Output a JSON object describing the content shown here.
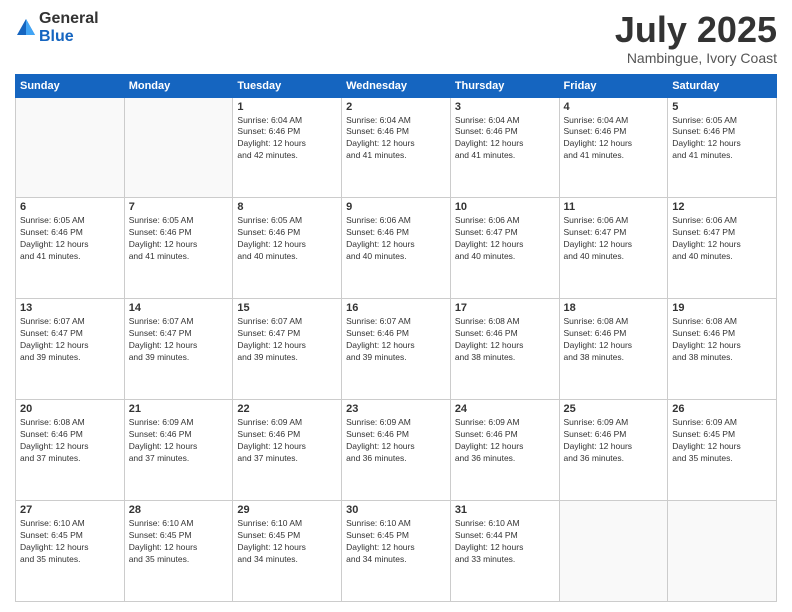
{
  "logo": {
    "general": "General",
    "blue": "Blue"
  },
  "header": {
    "title": "July 2025",
    "subtitle": "Nambingue, Ivory Coast"
  },
  "weekdays": [
    "Sunday",
    "Monday",
    "Tuesday",
    "Wednesday",
    "Thursday",
    "Friday",
    "Saturday"
  ],
  "weeks": [
    [
      {
        "day": "",
        "info": ""
      },
      {
        "day": "",
        "info": ""
      },
      {
        "day": "1",
        "info": "Sunrise: 6:04 AM\nSunset: 6:46 PM\nDaylight: 12 hours\nand 42 minutes."
      },
      {
        "day": "2",
        "info": "Sunrise: 6:04 AM\nSunset: 6:46 PM\nDaylight: 12 hours\nand 41 minutes."
      },
      {
        "day": "3",
        "info": "Sunrise: 6:04 AM\nSunset: 6:46 PM\nDaylight: 12 hours\nand 41 minutes."
      },
      {
        "day": "4",
        "info": "Sunrise: 6:04 AM\nSunset: 6:46 PM\nDaylight: 12 hours\nand 41 minutes."
      },
      {
        "day": "5",
        "info": "Sunrise: 6:05 AM\nSunset: 6:46 PM\nDaylight: 12 hours\nand 41 minutes."
      }
    ],
    [
      {
        "day": "6",
        "info": "Sunrise: 6:05 AM\nSunset: 6:46 PM\nDaylight: 12 hours\nand 41 minutes."
      },
      {
        "day": "7",
        "info": "Sunrise: 6:05 AM\nSunset: 6:46 PM\nDaylight: 12 hours\nand 41 minutes."
      },
      {
        "day": "8",
        "info": "Sunrise: 6:05 AM\nSunset: 6:46 PM\nDaylight: 12 hours\nand 40 minutes."
      },
      {
        "day": "9",
        "info": "Sunrise: 6:06 AM\nSunset: 6:46 PM\nDaylight: 12 hours\nand 40 minutes."
      },
      {
        "day": "10",
        "info": "Sunrise: 6:06 AM\nSunset: 6:47 PM\nDaylight: 12 hours\nand 40 minutes."
      },
      {
        "day": "11",
        "info": "Sunrise: 6:06 AM\nSunset: 6:47 PM\nDaylight: 12 hours\nand 40 minutes."
      },
      {
        "day": "12",
        "info": "Sunrise: 6:06 AM\nSunset: 6:47 PM\nDaylight: 12 hours\nand 40 minutes."
      }
    ],
    [
      {
        "day": "13",
        "info": "Sunrise: 6:07 AM\nSunset: 6:47 PM\nDaylight: 12 hours\nand 39 minutes."
      },
      {
        "day": "14",
        "info": "Sunrise: 6:07 AM\nSunset: 6:47 PM\nDaylight: 12 hours\nand 39 minutes."
      },
      {
        "day": "15",
        "info": "Sunrise: 6:07 AM\nSunset: 6:47 PM\nDaylight: 12 hours\nand 39 minutes."
      },
      {
        "day": "16",
        "info": "Sunrise: 6:07 AM\nSunset: 6:46 PM\nDaylight: 12 hours\nand 39 minutes."
      },
      {
        "day": "17",
        "info": "Sunrise: 6:08 AM\nSunset: 6:46 PM\nDaylight: 12 hours\nand 38 minutes."
      },
      {
        "day": "18",
        "info": "Sunrise: 6:08 AM\nSunset: 6:46 PM\nDaylight: 12 hours\nand 38 minutes."
      },
      {
        "day": "19",
        "info": "Sunrise: 6:08 AM\nSunset: 6:46 PM\nDaylight: 12 hours\nand 38 minutes."
      }
    ],
    [
      {
        "day": "20",
        "info": "Sunrise: 6:08 AM\nSunset: 6:46 PM\nDaylight: 12 hours\nand 37 minutes."
      },
      {
        "day": "21",
        "info": "Sunrise: 6:09 AM\nSunset: 6:46 PM\nDaylight: 12 hours\nand 37 minutes."
      },
      {
        "day": "22",
        "info": "Sunrise: 6:09 AM\nSunset: 6:46 PM\nDaylight: 12 hours\nand 37 minutes."
      },
      {
        "day": "23",
        "info": "Sunrise: 6:09 AM\nSunset: 6:46 PM\nDaylight: 12 hours\nand 36 minutes."
      },
      {
        "day": "24",
        "info": "Sunrise: 6:09 AM\nSunset: 6:46 PM\nDaylight: 12 hours\nand 36 minutes."
      },
      {
        "day": "25",
        "info": "Sunrise: 6:09 AM\nSunset: 6:46 PM\nDaylight: 12 hours\nand 36 minutes."
      },
      {
        "day": "26",
        "info": "Sunrise: 6:09 AM\nSunset: 6:45 PM\nDaylight: 12 hours\nand 35 minutes."
      }
    ],
    [
      {
        "day": "27",
        "info": "Sunrise: 6:10 AM\nSunset: 6:45 PM\nDaylight: 12 hours\nand 35 minutes."
      },
      {
        "day": "28",
        "info": "Sunrise: 6:10 AM\nSunset: 6:45 PM\nDaylight: 12 hours\nand 35 minutes."
      },
      {
        "day": "29",
        "info": "Sunrise: 6:10 AM\nSunset: 6:45 PM\nDaylight: 12 hours\nand 34 minutes."
      },
      {
        "day": "30",
        "info": "Sunrise: 6:10 AM\nSunset: 6:45 PM\nDaylight: 12 hours\nand 34 minutes."
      },
      {
        "day": "31",
        "info": "Sunrise: 6:10 AM\nSunset: 6:44 PM\nDaylight: 12 hours\nand 33 minutes."
      },
      {
        "day": "",
        "info": ""
      },
      {
        "day": "",
        "info": ""
      }
    ]
  ]
}
